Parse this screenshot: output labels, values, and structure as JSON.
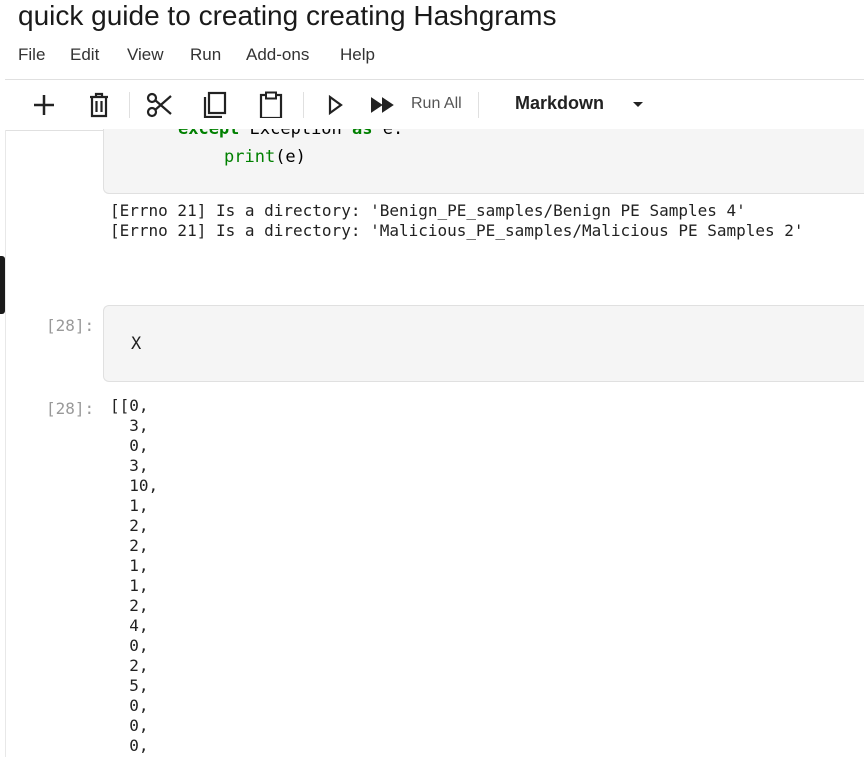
{
  "notebook": {
    "title": "quick guide to creating creating Hashgrams"
  },
  "menu": [
    "File",
    "Edit",
    "View",
    "Run",
    "Add-ons",
    "Help"
  ],
  "toolbar": {
    "run_all_label": "Run All",
    "cell_type": "Markdown",
    "icons": [
      "plus-icon",
      "trash-icon",
      "scissors-icon",
      "copy-icon",
      "paste-icon",
      "run-icon",
      "run-all-icon"
    ]
  },
  "cell1": {
    "code_line_1_kw1": "except",
    "code_line_1_rest": " Exception ",
    "code_line_1_kw2": "as",
    "code_line_1_end": " e:",
    "code_line_2_fn": "print",
    "code_line_2_rest": "(e)",
    "output": [
      "[Errno 21] Is a directory: 'Benign_PE_samples/Benign PE Samples 4'",
      "[Errno 21] Is a directory: 'Malicious_PE_samples/Malicious PE Samples 2'"
    ]
  },
  "cell2": {
    "prompt_in": "[28]:",
    "code": "X",
    "prompt_out": "[28]:",
    "output_lines": [
      "[[0,",
      "  3,",
      "  0,",
      "  3,",
      "  10,",
      "  1,",
      "  2,",
      "  2,",
      "  1,",
      "  1,",
      "  2,",
      "  4,",
      "  0,",
      "  2,",
      "  5,",
      "  0,",
      "  0,",
      "  0,"
    ]
  }
}
